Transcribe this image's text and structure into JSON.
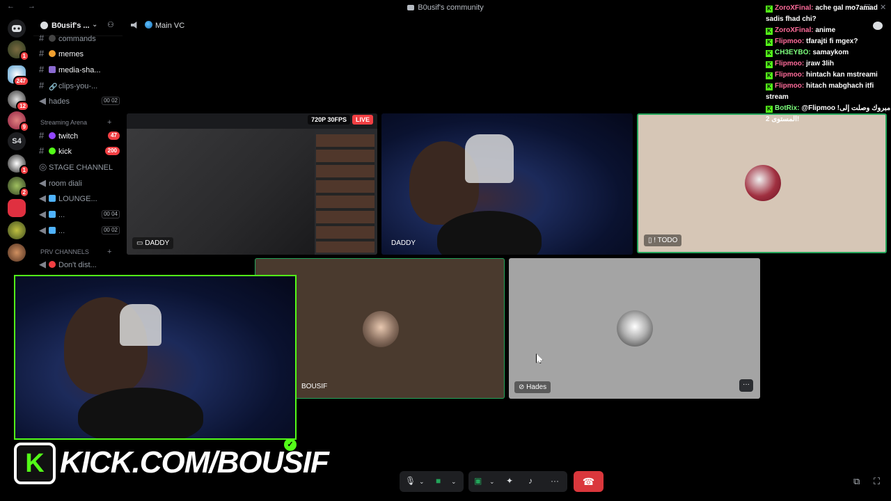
{
  "window": {
    "title": "B0usif's community",
    "nav": "← →"
  },
  "guild_rail": {
    "badges": [
      "1",
      "247",
      "12",
      "9",
      "1",
      "2"
    ],
    "s4_label": "S4"
  },
  "server": {
    "name": "B0usif's ..."
  },
  "channels": [
    {
      "name": "commands",
      "type": "text"
    },
    {
      "name": "memes",
      "type": "text"
    },
    {
      "name": "media-sha...",
      "type": "text"
    },
    {
      "name": "clips-you-...",
      "type": "text"
    },
    {
      "name": "hades",
      "type": "voice",
      "counts": "00 02"
    },
    {
      "name": "twitch",
      "type": "text",
      "badge": "47"
    },
    {
      "name": "kick",
      "type": "text",
      "badge": "200"
    },
    {
      "name": "STAGE CHANNEL",
      "type": "stage"
    },
    {
      "name": "room diali",
      "type": "voice"
    },
    {
      "name": "LOUNGE...",
      "type": "voice"
    },
    {
      "name": "...",
      "type": "voice",
      "counts": "00 04"
    },
    {
      "name": "...",
      "type": "voice",
      "counts": "00 02"
    },
    {
      "name": "Don't dist...",
      "type": "voice"
    }
  ],
  "categories": {
    "streaming": "Streaming Arena",
    "prv": "PRV CHANNELS"
  },
  "voice_header": {
    "channel": "Main VC"
  },
  "tiles": {
    "screen_share": {
      "user": "DADDY",
      "quality": "720P 30FPS",
      "live": "LIVE"
    },
    "camera": {
      "user": "DADDY"
    },
    "todo": {
      "user": "! TODO"
    },
    "bousif": {
      "user": "BOUSIF"
    },
    "hades": {
      "user": "Hades",
      "more": "···"
    }
  },
  "chat": [
    {
      "user": "ZoroXFinal:",
      "msg": "ache gal mo7amad sadis fhad chi?",
      "color": "pink"
    },
    {
      "user": "ZoroXFinal:",
      "msg": "anime",
      "color": "pink"
    },
    {
      "user": "Flipmoo:",
      "msg": "tfarajti fi mgex?",
      "color": "pink"
    },
    {
      "user": "CH3EYBO:",
      "msg": "samaykom",
      "color": "green"
    },
    {
      "user": "Flipmoo:",
      "msg": "jraw 3lih",
      "color": "pink"
    },
    {
      "user": "Flipmoo:",
      "msg": "hintach kan mstreami",
      "color": "pink"
    },
    {
      "user": "Flipmoo:",
      "msg": "hitach mabghach itfi stream",
      "color": "pink"
    },
    {
      "user": "BotRix:",
      "msg": "@Flipmoo !مبروك وصلت إلى المستوى 2!",
      "color": "green"
    }
  ],
  "overlay": {
    "kick_url": "KICK.COM/BOUSIF",
    "kick_letter": "K",
    "verified": "✓"
  },
  "controls": {
    "more": "···",
    "hangup": "☎"
  },
  "colors": {
    "kick_green": "#53fc18",
    "hangup_red": "#da373c",
    "live_red": "#f23f43"
  }
}
